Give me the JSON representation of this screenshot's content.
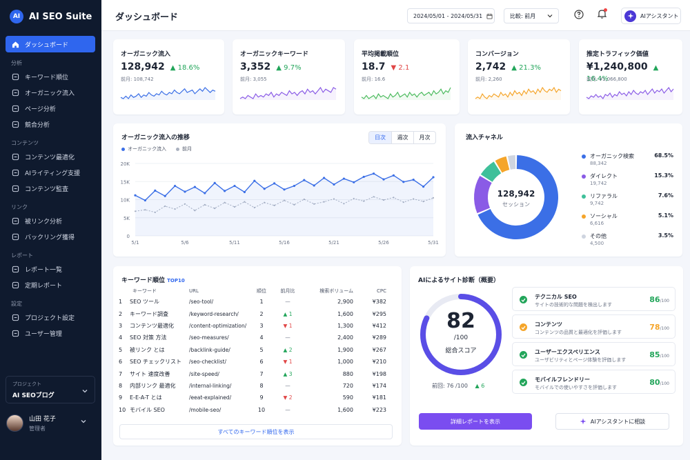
{
  "app": {
    "logo_badge": "AI",
    "name": "AI SEO Suite"
  },
  "sidebar": {
    "dashboard": "ダッシュボード",
    "sections": [
      {
        "title": "分析",
        "items": [
          "キーワード順位",
          "オーガニック流入",
          "ページ分析",
          "競合分析"
        ]
      },
      {
        "title": "コンテンツ",
        "items": [
          "コンテンツ最適化",
          "AIライティング支援",
          "コンテンツ監査"
        ]
      },
      {
        "title": "リンク",
        "items": [
          "被リンク分析",
          "バックリング獲得"
        ]
      },
      {
        "title": "レポート",
        "items": [
          "レポート一覧",
          "定期レポート"
        ]
      },
      {
        "title": "設定",
        "items": [
          "プロジェクト設定",
          "ユーザー管理"
        ]
      }
    ],
    "project_label": "プロジェクト",
    "project_value": "AI SEOブログ",
    "user_name": "山田 花子",
    "user_role": "管理者"
  },
  "header": {
    "title": "ダッシュボード",
    "date_range": "2024/05/01 - 2024/05/31",
    "compare": "比較: 前月",
    "ai_button": "AIアシスタント"
  },
  "kpis": [
    {
      "title": "オーガニック流入",
      "value": "128,942",
      "change": "18.6%",
      "dir": "up",
      "prev": "前月: 108,742",
      "color": "#3b6fe6",
      "spark": [
        6,
        5,
        7,
        5,
        8,
        6,
        7,
        9,
        6,
        8,
        7,
        10,
        8,
        7,
        9,
        8,
        11,
        9,
        8,
        10,
        9,
        12,
        10,
        9,
        11,
        13,
        10,
        11,
        12,
        9,
        11,
        13,
        11,
        14,
        12,
        10,
        12,
        11
      ]
    },
    {
      "title": "オーガニックキーワード",
      "value": "3,352",
      "change": "9.7%",
      "dir": "up",
      "prev": "前月: 3,055",
      "color": "#8a5be6",
      "spark": [
        5,
        6,
        5,
        7,
        6,
        5,
        8,
        6,
        7,
        6,
        8,
        7,
        9,
        6,
        8,
        7,
        9,
        8,
        7,
        10,
        8,
        9,
        7,
        9,
        10,
        8,
        11,
        9,
        10,
        8,
        10,
        12,
        9,
        11,
        10,
        9,
        12,
        11
      ]
    },
    {
      "title": "平均掲載順位",
      "value": "18.7",
      "change": "2.1",
      "dir": "down",
      "prev": "前月: 16.6",
      "color": "#4cbb5e",
      "spark": [
        6,
        5,
        7,
        5,
        6,
        7,
        5,
        8,
        6,
        7,
        6,
        5,
        8,
        6,
        7,
        9,
        6,
        7,
        8,
        6,
        9,
        7,
        8,
        6,
        8,
        9,
        7,
        8,
        9,
        7,
        10,
        8,
        9,
        11,
        8,
        10,
        9,
        12
      ]
    },
    {
      "title": "コンバージョン",
      "value": "2,742",
      "change": "21.3%",
      "dir": "up",
      "prev": "前月: 2,260",
      "color": "#f5a52a",
      "spark": [
        5,
        6,
        5,
        8,
        6,
        5,
        7,
        6,
        8,
        7,
        6,
        9,
        7,
        8,
        6,
        9,
        7,
        10,
        8,
        9,
        7,
        10,
        8,
        11,
        9,
        10,
        8,
        11,
        9,
        12,
        10,
        9,
        11,
        10,
        12,
        9,
        11,
        10
      ]
    },
    {
      "title": "推定トラフィック価値",
      "value": "¥1,240,800",
      "change": "16.4%",
      "dir": "up",
      "prev": "前月: ¥1,066,800",
      "color": "#8a5be6",
      "spark": [
        6,
        5,
        7,
        6,
        8,
        6,
        7,
        5,
        8,
        7,
        9,
        6,
        8,
        7,
        10,
        8,
        9,
        7,
        10,
        8,
        11,
        9,
        8,
        10,
        9,
        11,
        8,
        10,
        12,
        9,
        11,
        10,
        12,
        9,
        11,
        13,
        10,
        12
      ]
    }
  ],
  "traffic": {
    "title": "オーガニック流入の推移",
    "tabs": [
      "日次",
      "週次",
      "月次"
    ],
    "legend": [
      "オーガニック流入",
      "前月"
    ],
    "chart_data": {
      "type": "line",
      "x": [
        "5/1",
        "5/2",
        "5/3",
        "5/4",
        "5/5",
        "5/6",
        "5/7",
        "5/8",
        "5/9",
        "5/10",
        "5/11",
        "5/12",
        "5/13",
        "5/14",
        "5/15",
        "5/16",
        "5/17",
        "5/18",
        "5/19",
        "5/20",
        "5/21",
        "5/22",
        "5/23",
        "5/24",
        "5/25",
        "5/26",
        "5/27",
        "5/28",
        "5/29",
        "5/30",
        "5/31"
      ],
      "xticks": [
        "5/1",
        "5/6",
        "5/11",
        "5/16",
        "5/21",
        "5/26",
        "5/31"
      ],
      "yticks": [
        "0",
        "5K",
        "10K",
        "15K",
        "20K"
      ],
      "ylim": [
        0,
        20000
      ],
      "series": [
        {
          "name": "オーガニック流入",
          "color": "#3b6fe6",
          "values": [
            11200,
            9800,
            12500,
            11000,
            13800,
            12200,
            13500,
            11800,
            14600,
            12400,
            13800,
            12100,
            15200,
            13000,
            14500,
            12800,
            13800,
            15400,
            13900,
            16000,
            14200,
            15800,
            14800,
            16300,
            17200,
            15600,
            16700,
            14900,
            15500,
            13600,
            16200
          ]
        },
        {
          "name": "前月",
          "color": "#aab1bf",
          "values": [
            6800,
            7200,
            6500,
            8200,
            7400,
            8800,
            7000,
            8600,
            7600,
            9200,
            8000,
            9400,
            7800,
            9200,
            8400,
            9800,
            8600,
            10100,
            8800,
            9400,
            10200,
            8900,
            10300,
            9600,
            10800,
            9900,
            10600,
            9300,
            10200,
            9500,
            10500
          ]
        }
      ]
    }
  },
  "channels": {
    "title": "流入チャネル",
    "center_value": "128,942",
    "center_label": "セッション",
    "chart_data": {
      "type": "pie",
      "items": [
        {
          "name": "オーガニック検索",
          "count": "88,342",
          "percent": "68.5%",
          "value": 68.5,
          "color": "#3b6fe6"
        },
        {
          "name": "ダイレクト",
          "count": "19,742",
          "percent": "15.3%",
          "value": 15.3,
          "color": "#8a5be6"
        },
        {
          "name": "リファラル",
          "count": "9,742",
          "percent": "7.6%",
          "value": 7.6,
          "color": "#3fc09a"
        },
        {
          "name": "ソーシャル",
          "count": "6,616",
          "percent": "5.1%",
          "value": 5.1,
          "color": "#f5a52a"
        },
        {
          "name": "その他",
          "count": "4,500",
          "percent": "3.5%",
          "value": 3.5,
          "color": "#cfd5e0"
        }
      ]
    }
  },
  "keywords": {
    "title": "キーワード順位",
    "title_suffix": "TOP10",
    "columns": [
      "キーワード",
      "URL",
      "順位",
      "前月比",
      "検索ボリューム",
      "CPC"
    ],
    "rows": [
      [
        "1",
        "SEO ツール",
        "/seo-tool/",
        "1",
        "—",
        "none",
        "2,900",
        "¥382"
      ],
      [
        "2",
        "キーワード調査",
        "/keyword-research/",
        "2",
        "1",
        "up",
        "1,600",
        "¥295"
      ],
      [
        "3",
        "コンテンツ最適化",
        "/content-optimization/",
        "3",
        "1",
        "down",
        "1,300",
        "¥412"
      ],
      [
        "4",
        "SEO 対策 方法",
        "/seo-measures/",
        "4",
        "—",
        "none",
        "2,400",
        "¥289"
      ],
      [
        "5",
        "被リンク とは",
        "/backlink-guide/",
        "5",
        "2",
        "up",
        "1,900",
        "¥267"
      ],
      [
        "6",
        "SEO チェックリスト",
        "/seo-checklist/",
        "6",
        "1",
        "down",
        "1,000",
        "¥210"
      ],
      [
        "7",
        "サイト 速度改善",
        "/site-speed/",
        "7",
        "3",
        "up",
        "880",
        "¥198"
      ],
      [
        "8",
        "内部リンク 最適化",
        "/internal-linking/",
        "8",
        "—",
        "none",
        "720",
        "¥174"
      ],
      [
        "9",
        "E-E-A-T とは",
        "/eeat-explained/",
        "9",
        "2",
        "down",
        "590",
        "¥181"
      ],
      [
        "10",
        "モバイル SEO",
        "/mobile-seo/",
        "10",
        "—",
        "none",
        "1,600",
        "¥223"
      ]
    ],
    "view_all": "すべてのキーワード順位を表示"
  },
  "diagnosis": {
    "title": "AIによるサイト診断（概要）",
    "score": "82",
    "score_fraction": 0.82,
    "out_of": "/100",
    "score_label": "総合スコア",
    "prev": "前回: 76 /100",
    "prev_change": "6",
    "items": [
      {
        "name": "テクニカル SEO",
        "desc": "サイトの技術的な問題を検出します",
        "score": "86",
        "max": "/100",
        "color": "#22a55a"
      },
      {
        "name": "コンテンツ",
        "desc": "コンテンツの品質と最適化を評価します",
        "score": "78",
        "max": "/100",
        "color": "#f5a52a"
      },
      {
        "name": "ユーザーエクスペリエンス",
        "desc": "ユーザビリティとページ体験を評価します",
        "score": "85",
        "max": "/100",
        "color": "#22a55a"
      },
      {
        "name": "モバイルフレンドリー",
        "desc": "モバイルでの使いやすさを評価します",
        "score": "80",
        "max": "/100",
        "color": "#22a55a"
      }
    ],
    "primary_button": "詳細レポートを表示",
    "secondary_button": "AIアシスタントに相談"
  }
}
